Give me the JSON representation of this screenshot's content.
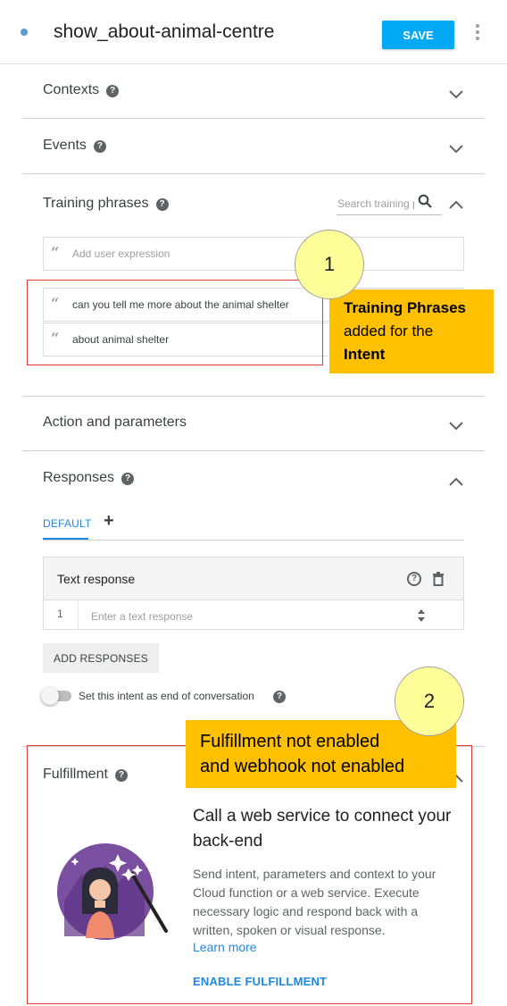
{
  "header": {
    "intent_name": "show_about-animal-centre",
    "save_label": "SAVE"
  },
  "sections": {
    "contexts": "Contexts",
    "events": "Events",
    "training_phrases": "Training phrases",
    "action_parameters": "Action and parameters",
    "responses": "Responses",
    "fulfillment": "Fulfillment"
  },
  "training": {
    "search_placeholder": "Search training phrases",
    "add_placeholder": "Add user expression",
    "phrases": [
      "can you tell me more about the animal shelter",
      "about animal shelter"
    ]
  },
  "callouts": [
    {
      "number": "1",
      "label_line1": "Training Phrases",
      "label_line2": "added for the",
      "label_line3": "Intent"
    },
    {
      "number": "2",
      "label_line1": "Fulfillment not enabled",
      "label_line2": "and webhook not enabled"
    }
  ],
  "responses": {
    "tab_default": "DEFAULT",
    "tab_add": "+",
    "card_title": "Text response",
    "row_number": "1",
    "row_placeholder": "Enter a text response",
    "add_responses": "ADD RESPONSES",
    "end_conversation_label": "Set this intent as end of conversation",
    "end_conversation_enabled": false
  },
  "fulfillment": {
    "title": "Call a web service to connect your back-end",
    "description": "Send intent, parameters and context to your Cloud function or a web service. Execute necessary logic and respond back with a written, spoken or visual response.",
    "learn_more": "Learn more",
    "enable": "ENABLE FULFILLMENT"
  },
  "colors": {
    "accent": "#03a9f4",
    "link": "#1e88e5",
    "callout_fill": "#ffc000",
    "callout_circle": "#ffff99",
    "highlight_border": "#e53935"
  }
}
